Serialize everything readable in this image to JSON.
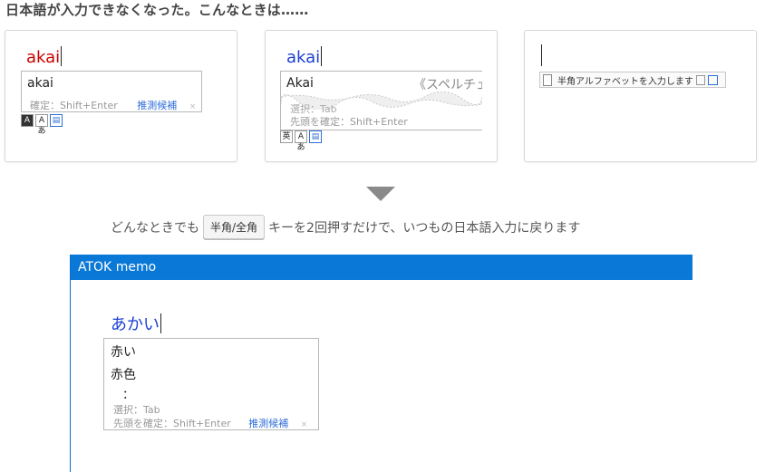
{
  "heading": "日本語が入力できなくなった。こんなときは……",
  "card1": {
    "typed": "akai",
    "typed_color": "#cc0000",
    "candidate": "akai",
    "hint_confirm": "確定：Shift+Enter",
    "hint_guess": "推測候補",
    "close": "×",
    "tools": [
      "A",
      "Aあ",
      "▤"
    ]
  },
  "card2": {
    "typed": "akai",
    "typed_color": "#1a3fd6",
    "candidate": "Akai",
    "spell": "《スペルチェ",
    "hint_select": "選択：Tab",
    "hint_confirm": "先頭を確定：Shift+Enter",
    "tools": [
      "英",
      "Aあ",
      "▤"
    ]
  },
  "card3": {
    "hint": "半角アルファベットを入力します"
  },
  "instruction": {
    "before": "どんなときでも",
    "key": "半角/全角",
    "after": "キーを2回押すだけで、いつもの日本語入力に戻ります"
  },
  "memo": {
    "title": "ATOK memo",
    "typed": "あかい",
    "typed_color": "#1a3fd6",
    "candidates": [
      "赤い",
      "赤色"
    ],
    "more": "：",
    "hint_select": "選択：Tab",
    "hint_confirm": "先頭を確定：Shift+Enter",
    "hint_guess": "推測候補",
    "close": "×"
  }
}
